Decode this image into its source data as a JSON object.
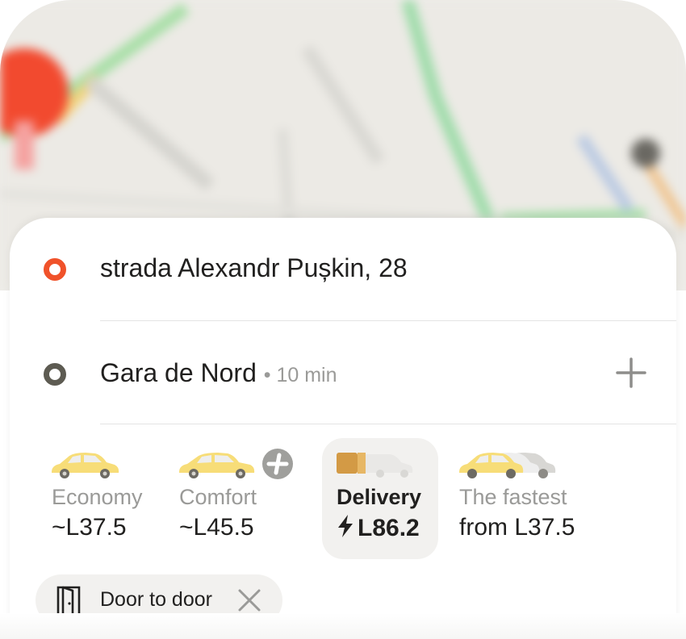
{
  "route": {
    "from": {
      "address": "strada Alexandr Pușkin, 28"
    },
    "to": {
      "address": "Gara de Nord",
      "eta": "10 min",
      "add_icon": "plus-icon"
    }
  },
  "tariffs": [
    {
      "name": "Economy",
      "price": "~L37.5",
      "selected": false,
      "icon": "economy-car-icon"
    },
    {
      "name": "Comfort",
      "price": "~L45.5",
      "selected": false,
      "icon": "comfort-car-icon",
      "badge_icon": "plus-badge-icon"
    },
    {
      "name": "Delivery",
      "price": "L86.2",
      "selected": true,
      "icon": "delivery-van-icon",
      "price_icon": "lightning-icon"
    },
    {
      "name": "The fastest",
      "price": "from L37.5",
      "selected": false,
      "icon": "fastest-cars-icon"
    }
  ],
  "options": {
    "door_to_door": {
      "label": "Door to door",
      "icon": "door-icon",
      "remove_icon": "close-icon"
    }
  },
  "colors": {
    "origin_marker": "#f0522a",
    "destination_marker": "#5d5b52",
    "selected_tariff_bg": "#f2f1ef",
    "car_yellow": "#f7dd78"
  }
}
